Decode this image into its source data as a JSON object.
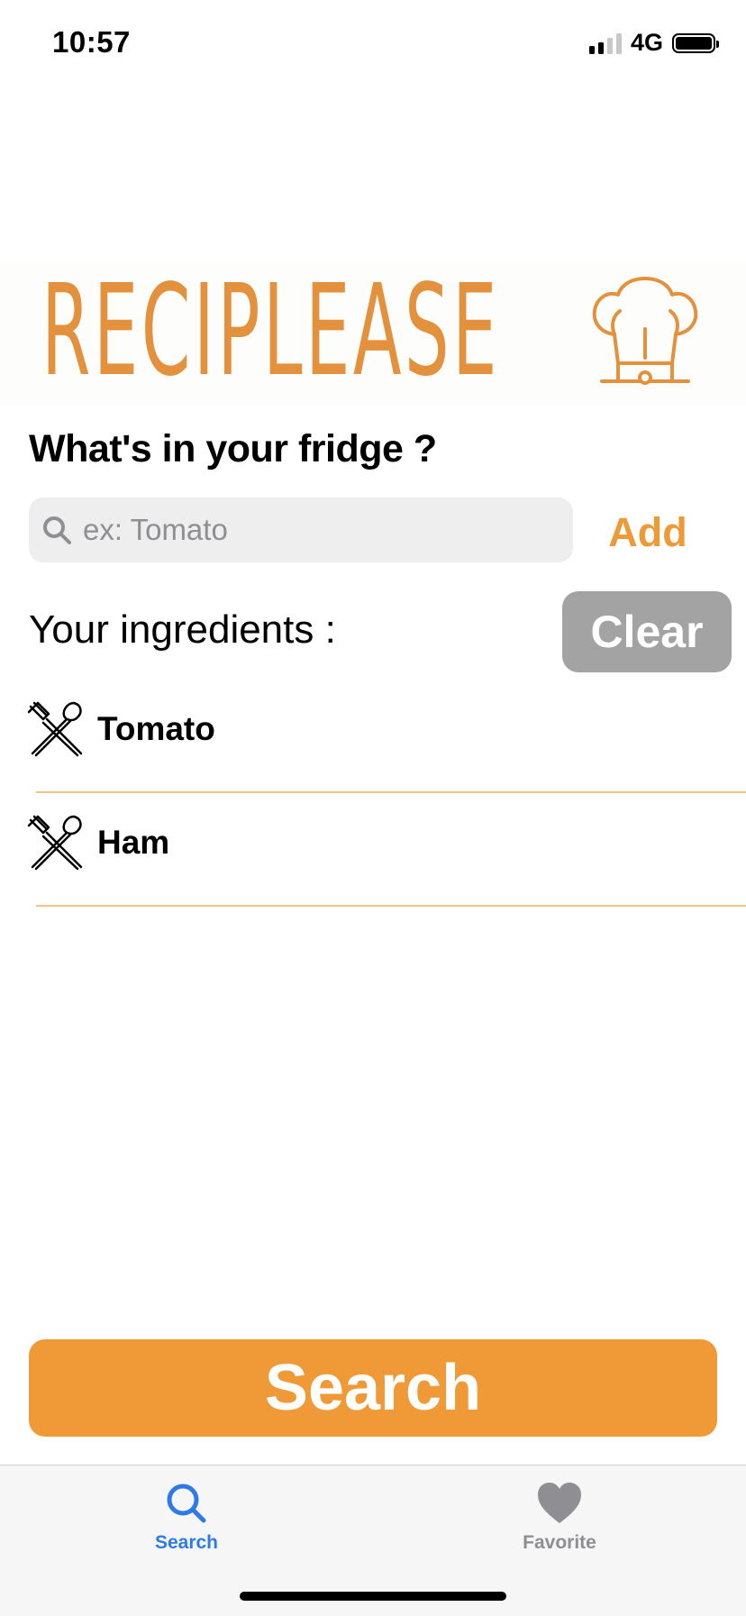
{
  "status_bar": {
    "time": "10:57",
    "network": "4G",
    "signal_bars_active": 2,
    "signal_bars_total": 4,
    "battery_level": 1.0
  },
  "logo": {
    "text": "RECIPLEASE",
    "color": "#e4913d"
  },
  "prompt": {
    "title": "What's in your fridge ?"
  },
  "search": {
    "placeholder": "ex: Tomato",
    "value": "",
    "add_label": "Add"
  },
  "ingredients": {
    "header": "Your ingredients :",
    "clear_label": "Clear",
    "items": [
      {
        "name": "Tomato",
        "icon": "fork-spoon-icon"
      },
      {
        "name": "Ham",
        "icon": "fork-spoon-icon"
      }
    ]
  },
  "actions": {
    "search_label": "Search"
  },
  "tabbar": {
    "tabs": [
      {
        "label": "Search",
        "icon": "search-icon",
        "selected": true
      },
      {
        "label": "Favorite",
        "icon": "heart-icon",
        "selected": false
      }
    ]
  },
  "colors": {
    "accent": "#ef9a37",
    "tab_selected": "#2f7be6",
    "clear_button": "#a3a3a3",
    "separator": "#f0c388"
  }
}
